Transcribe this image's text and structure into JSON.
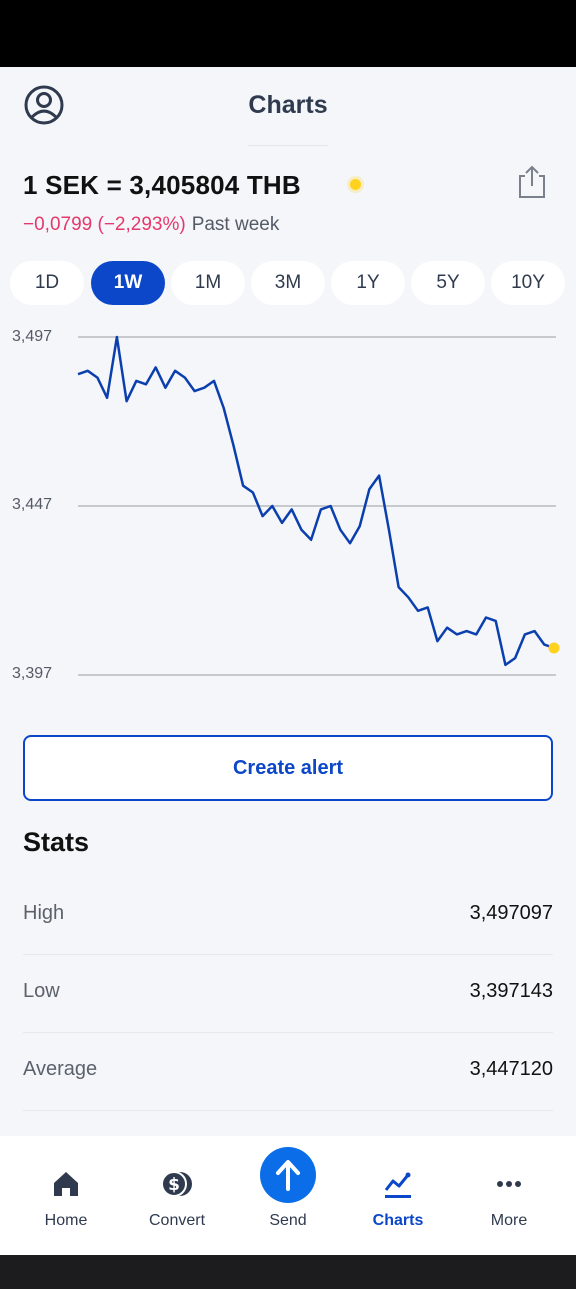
{
  "header": {
    "title": "Charts"
  },
  "rate": {
    "text": "1 SEK = 3,405804 THB"
  },
  "change": {
    "value": "−0,0799 (−2,293%)",
    "period": "Past week"
  },
  "periods": [
    {
      "label": "1D",
      "active": false
    },
    {
      "label": "1W",
      "active": true
    },
    {
      "label": "1M",
      "active": false
    },
    {
      "label": "3M",
      "active": false
    },
    {
      "label": "1Y",
      "active": false
    },
    {
      "label": "5Y",
      "active": false
    },
    {
      "label": "10Y",
      "active": false
    }
  ],
  "chart_data": {
    "type": "line",
    "ylim": [
      3.397,
      3.497
    ],
    "y_ticks": [
      "3,497",
      "3,447",
      "3,397"
    ],
    "grid": true,
    "series": [
      {
        "values": [
          3.486,
          3.487,
          3.485,
          3.479,
          3.497,
          3.478,
          3.484,
          3.483,
          3.488,
          3.482,
          3.487,
          3.485,
          3.481,
          3.482,
          3.484,
          3.476,
          3.465,
          3.453,
          3.451,
          3.444,
          3.447,
          3.442,
          3.446,
          3.44,
          3.437,
          3.446,
          3.447,
          3.44,
          3.436,
          3.441,
          3.452,
          3.456,
          3.44,
          3.423,
          3.42,
          3.416,
          3.417,
          3.407,
          3.411,
          3.409,
          3.41,
          3.409,
          3.414,
          3.413,
          3.4,
          3.402,
          3.409,
          3.41,
          3.406,
          3.405
        ]
      }
    ],
    "line_color": "#0b3fae",
    "endpoint_color": "#ffd21f"
  },
  "alert_button": {
    "label": "Create alert"
  },
  "stats": {
    "title": "Stats",
    "rows": [
      {
        "label": "High",
        "value": "3,497097"
      },
      {
        "label": "Low",
        "value": "3,397143"
      },
      {
        "label": "Average",
        "value": "3,447120"
      }
    ]
  },
  "nav": [
    {
      "label": "Home",
      "icon": "home-icon",
      "active": false
    },
    {
      "label": "Convert",
      "icon": "convert-icon",
      "active": false
    },
    {
      "label": "Send",
      "icon": "send-icon",
      "active": false
    },
    {
      "label": "Charts",
      "icon": "charts-icon",
      "active": true
    },
    {
      "label": "More",
      "icon": "more-icon",
      "active": false
    }
  ],
  "colors": {
    "accent": "#0b47c8",
    "negative": "#e5386c",
    "live": "#ffd21f",
    "send": "#0b6ee8"
  }
}
